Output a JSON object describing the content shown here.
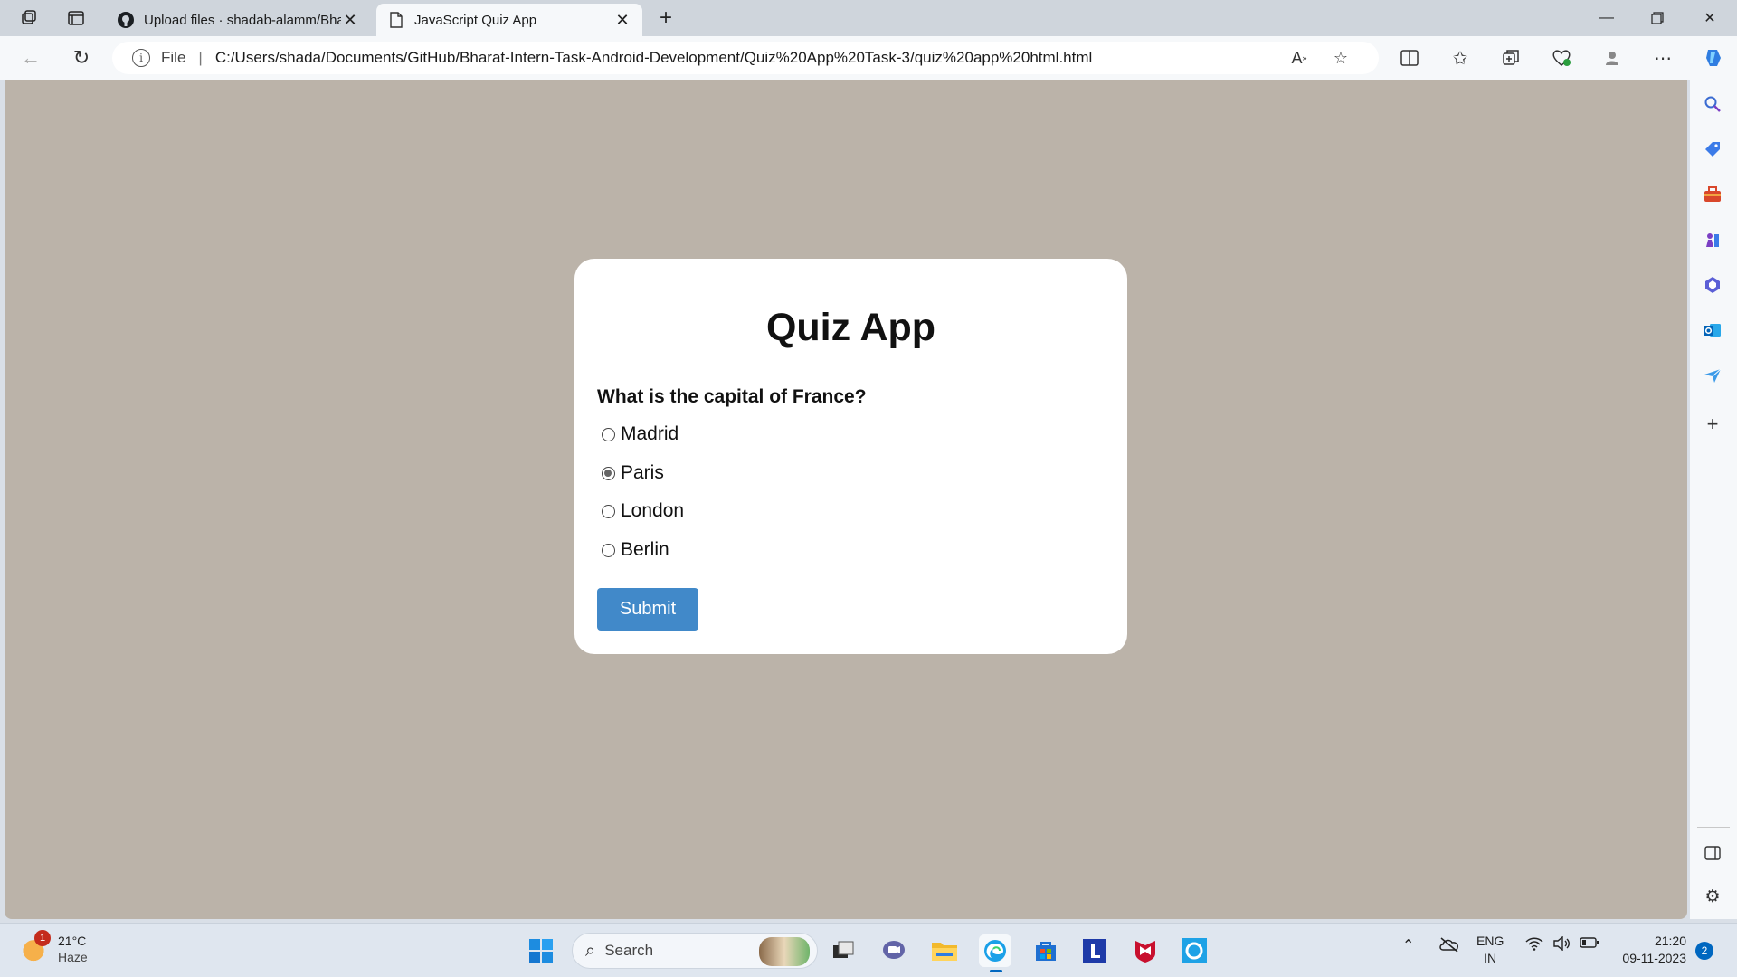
{
  "browser": {
    "tabs": [
      {
        "title": "Upload files · shadab-alamm/Bha",
        "icon": "github-icon"
      },
      {
        "title": "JavaScript Quiz App",
        "icon": "page-icon"
      }
    ],
    "address": {
      "scheme_label": "File",
      "url": "C:/Users/shada/Documents/GitHub/Bharat-Intern-Task-Android-Development/Quiz%20App%20Task-3/quiz%20app%20html.html"
    }
  },
  "quiz": {
    "title": "Quiz App",
    "question": "What is the capital of France?",
    "options": [
      "Madrid",
      "Paris",
      "London",
      "Berlin"
    ],
    "selected_option": "Paris",
    "submit_label": "Submit"
  },
  "taskbar": {
    "weather": {
      "badge": "1",
      "temp": "21°C",
      "condition": "Haze"
    },
    "search_placeholder": "Search",
    "lang": {
      "line1": "ENG",
      "line2": "IN"
    },
    "clock": {
      "time": "21:20",
      "date": "09-11-2023"
    },
    "notification_count": "2"
  },
  "colors": {
    "page_background": "#bbb3a9",
    "submit_button": "#4189c9"
  }
}
